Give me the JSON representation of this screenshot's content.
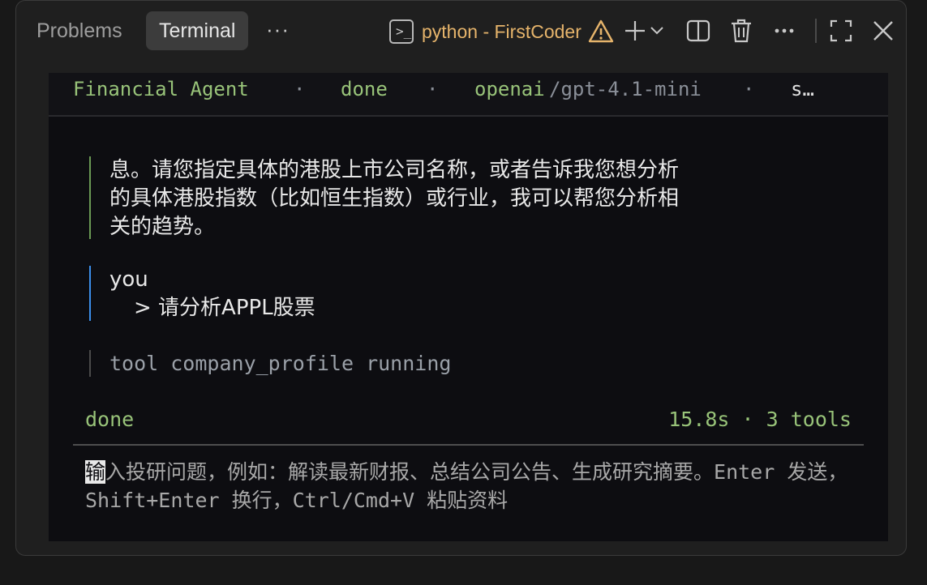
{
  "tabs": [
    {
      "label": "Problems"
    },
    {
      "label": "Terminal"
    }
  ],
  "tabs_more": "···",
  "process": {
    "label": "python - FirstCoder"
  },
  "icons": {
    "terminal": "terminal-icon",
    "warning": "warning-icon",
    "add": "plus-icon",
    "dropdown": "chevron-down-icon",
    "split": "split-editor-icon",
    "trash": "trash-icon",
    "more": "more-icon",
    "maximize": "maximize-icon",
    "close": "close-icon"
  },
  "header": {
    "agent": "Financial Agent",
    "dot1": "·",
    "status": "done",
    "dot2": "·",
    "provider": "openai",
    "model": "/gpt-4.1-mini",
    "dot3": "·",
    "extra": "s…"
  },
  "messages": {
    "assistant_lines": [
      "息。请您指定具体的港股上市公司名称，或者告诉我您想分析",
      "的具体港股指数（比如恒生指数）或行业，我可以帮您分析相",
      "关的趋势。"
    ],
    "user_name": "you",
    "user_prompt": "> 请分析APPL股票",
    "tool_line": "tool company_profile running"
  },
  "footer": {
    "status": "done",
    "stats": "15.8s · 3 tools"
  },
  "input": {
    "cursor_char": "输",
    "placeholder_rest": "入投研问题，例如：解读最新财报、总结公司公告、生成研究摘要。Enter 发送，Shift+Enter 换行，Ctrl/Cmd+V 粘贴资料"
  },
  "colors": {
    "accent_green": "#98c379",
    "warning_orange": "#e6b46b",
    "assistant_bar": "#6a9955",
    "user_bar": "#3b8eea"
  }
}
